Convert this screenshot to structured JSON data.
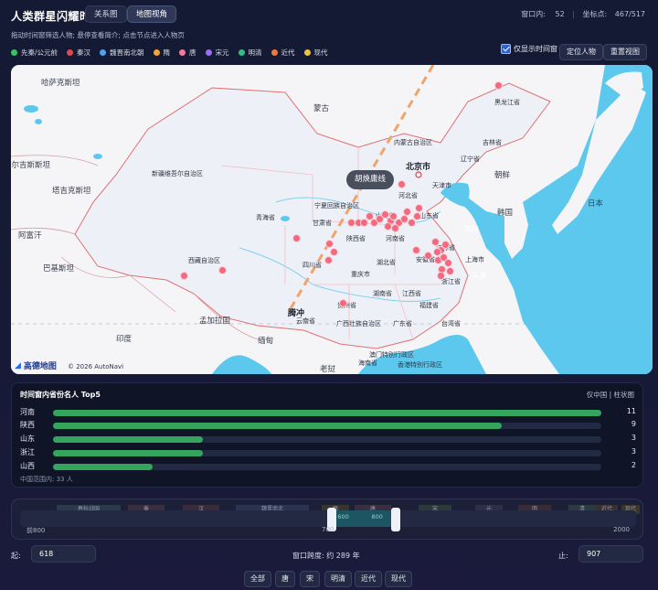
{
  "header": {
    "app_title": "人类群星闪耀时",
    "tabs": [
      {
        "label": "关系图",
        "active": false
      },
      {
        "label": "地图视角",
        "active": true
      }
    ],
    "window_count_label": "窗口内:",
    "window_count": "52",
    "coords_label": "坐标点:",
    "coords_value": "467/517"
  },
  "hint": "拖动时间窗筛选人物; 悬停查看简介; 点击节点进入人物页",
  "legend": [
    {
      "label": "先秦/公元前",
      "color": "#3fbf6a"
    },
    {
      "label": "秦汉",
      "color": "#e0484e"
    },
    {
      "label": "魏晋南北朝",
      "color": "#4aa4f0"
    },
    {
      "label": "隋",
      "color": "#f0a43a"
    },
    {
      "label": "唐",
      "color": "#f07aa2"
    },
    {
      "label": "宋元",
      "color": "#9d6cf0"
    },
    {
      "label": "明清",
      "color": "#2fbf8a"
    },
    {
      "label": "近代",
      "color": "#f07a3a"
    },
    {
      "label": "现代",
      "color": "#f0c23a"
    }
  ],
  "controls": {
    "only_window_label": "仅显示时间窗",
    "only_window_checked": true,
    "locate_button": "定位人物",
    "reset_button": "重置视图"
  },
  "map": {
    "huline_label": "胡焕庸线",
    "attribution": "© 2026 AutoNavi",
    "logo_text": "高德地图",
    "labels": {
      "kazakhstan": "哈萨克斯坦",
      "mongolia": "蒙古",
      "kyrgyzstan": "吉尔吉斯斯坦",
      "tajikistan": "塔吉克斯坦",
      "afghanistan": "阿富汗",
      "pakistan": "巴基斯坦",
      "india": "印度",
      "bangladesh": "孟加拉国",
      "myanmar": "缅甸",
      "laos": "老挝",
      "nkorea": "朝鲜",
      "skorea": "韩国",
      "japan": "日本",
      "yellow_sea": "黄海",
      "east_sea": "东海",
      "beijing": "北京市",
      "shanghai": "上海市",
      "tianjin": "天津市",
      "heilongjiang": "黑龙江省",
      "jilin": "吉林省",
      "liaoning": "辽宁省",
      "neimenggu": "内蒙古自治区",
      "xinjiang": "新疆维吾尔自治区",
      "xizang": "西藏自治区",
      "qinghai": "青海省",
      "gansu": "甘肃省",
      "ningxia": "宁夏回族自治区",
      "shanxi": "山西省",
      "shaanxi": "陕西省",
      "hebei": "河北省",
      "shandong": "山东省",
      "henan": "河南省",
      "sichuan": "四川省",
      "hubei": "湖北省",
      "chongqing": "重庆市",
      "anhui": "安徽省",
      "jiangsu": "江苏省",
      "zhejiang": "浙江省",
      "hunan": "湖南省",
      "jiangxi": "江西省",
      "guizhou": "贵州省",
      "fujian": "福建省",
      "guangxi": "广西壮族自治区",
      "guangdong": "广东省",
      "taiwan": "台湾省",
      "tengchong": "腾冲",
      "yunnan": "云南省",
      "hainan": "海南省",
      "macau": "澳门特别行政区",
      "hongkong": "香港特别行政区"
    }
  },
  "top5": {
    "title": "时间窗内省份名人 Top5",
    "right_label": "仅中国 | 柱状图",
    "max": 11,
    "rows": [
      {
        "province": "河南",
        "count": 11
      },
      {
        "province": "陕西",
        "count": 9
      },
      {
        "province": "山东",
        "count": 3
      },
      {
        "province": "浙江",
        "count": 3
      },
      {
        "province": "山西",
        "count": 2
      }
    ],
    "footer": "中国范围内: 33 人"
  },
  "timeline": {
    "min_label": "前800",
    "mid_label": "700",
    "max_label": "2000",
    "range_start": 618,
    "range_end": 907,
    "inner_left": "600",
    "inner_right": "800",
    "eras": [
      {
        "label": "春秋战国"
      },
      {
        "label": "秦"
      },
      {
        "label": "汉"
      },
      {
        "label": "魏晋南北"
      },
      {
        "label": "隋"
      },
      {
        "label": "唐"
      },
      {
        "label": "宋"
      },
      {
        "label": "元"
      },
      {
        "label": "明"
      },
      {
        "label": "清"
      },
      {
        "label": "近代"
      },
      {
        "label": "现代"
      }
    ]
  },
  "window": {
    "start_label": "起:",
    "start_value": "618",
    "span_text": "窗口跨度: 约 289 年",
    "end_label": "止:",
    "end_value": "907"
  },
  "presets": [
    {
      "label": "全部"
    },
    {
      "label": "唐"
    },
    {
      "label": "宋"
    },
    {
      "label": "明清"
    },
    {
      "label": "近代"
    },
    {
      "label": "现代"
    }
  ]
}
